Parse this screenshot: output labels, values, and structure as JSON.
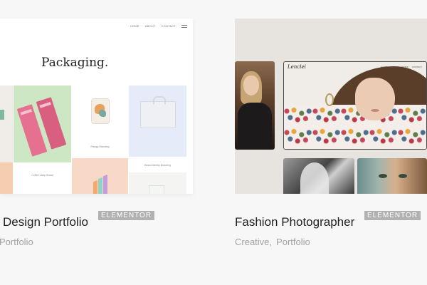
{
  "cards": [
    {
      "preview": {
        "nav": [
          "HOME",
          "ABOUT",
          "CONTACT"
        ],
        "heading": "Packaging.",
        "captions": [
          "Coffee Lamp Brand",
          "Preppy Branding",
          "Buzz Branding",
          "Brand Identity Branding"
        ]
      },
      "title": "Design Portfolio",
      "badge": "ELEMENTOR",
      "tags": [
        "Portfolio"
      ]
    },
    {
      "preview": {
        "logo": "Lenclei",
        "nav": [
          "HOME",
          "ABOUT",
          "WORK",
          "CONTACT"
        ]
      },
      "title": "Fashion Photographer",
      "badge": "ELEMENTOR",
      "tags": [
        "Creative",
        "Portfolio"
      ]
    }
  ]
}
